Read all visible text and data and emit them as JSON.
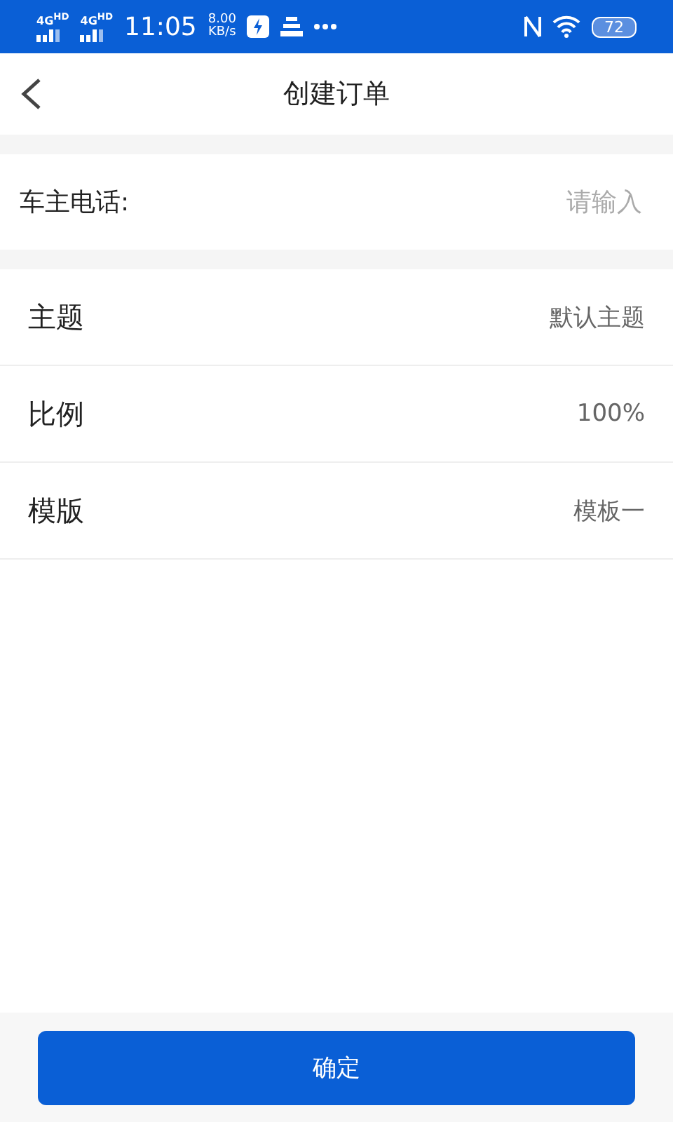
{
  "status_bar": {
    "signals": [
      "4G$^{HD}$",
      "4G$^{HD}$"
    ],
    "time": "11:05",
    "speed": "8.00",
    "speed_unit": "KB/s",
    "battery": "72"
  },
  "header": {
    "title": "创建订单"
  },
  "phone_field": {
    "label": "车主电话:",
    "placeholder": "请输入"
  },
  "settings": [
    {
      "label": "主题",
      "value": "默认主题"
    },
    {
      "label": "比例",
      "value": "100%"
    },
    {
      "label": "模版",
      "value": "模板一"
    }
  ],
  "confirm_button": "确定"
}
